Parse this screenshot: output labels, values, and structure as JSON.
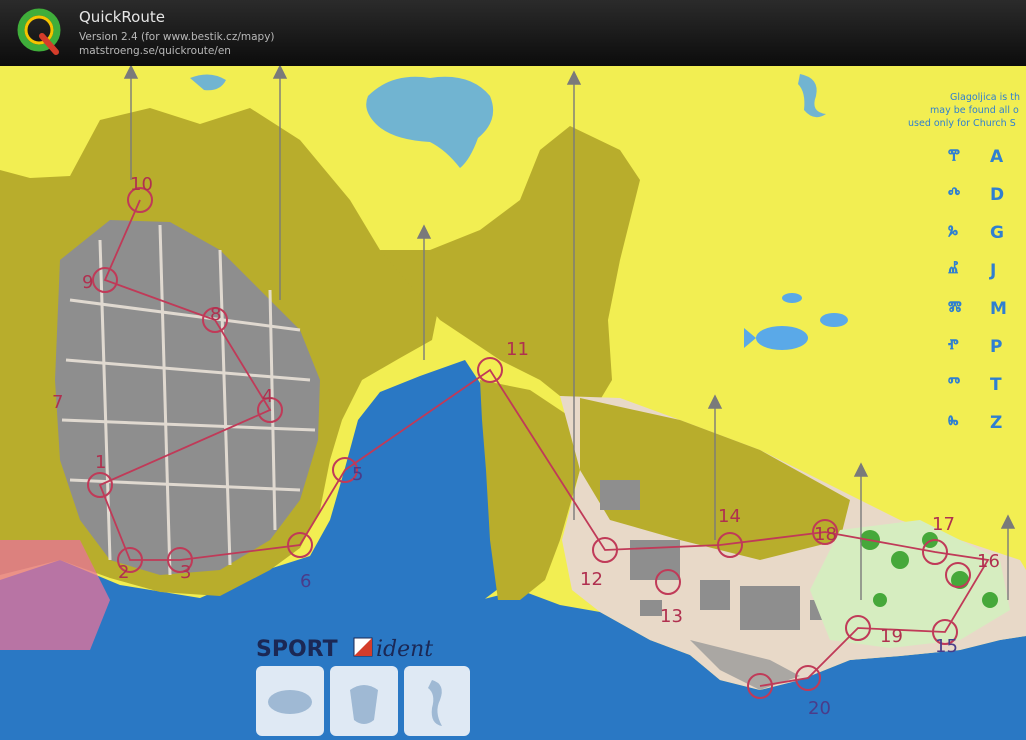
{
  "app": {
    "name": "QuickRoute",
    "version_line": "Version 2.4  (for www.bestik.cz/mapy)",
    "url_line": "matstroeng.se/quickroute/en",
    "logo_letter": "Q"
  },
  "map": {
    "legend_note": [
      "Glagoljica is th",
      "may be found all o",
      "used only for Church S"
    ],
    "glyph_legend": [
      {
        "glyph": "ⰹ",
        "latin": "A"
      },
      {
        "glyph": "ⰴ",
        "latin": "D"
      },
      {
        "glyph": "ⰳ",
        "latin": "G"
      },
      {
        "glyph": "ⰼ",
        "latin": "J"
      },
      {
        "glyph": "ⰿ",
        "latin": "M"
      },
      {
        "glyph": "ⱂ",
        "latin": "P"
      },
      {
        "glyph": "ⱅ",
        "latin": "T"
      },
      {
        "glyph": "ⰸ",
        "latin": "Z"
      }
    ],
    "controls": [
      "10",
      "9",
      "8",
      "4",
      "7",
      "1",
      "2",
      "3",
      "5",
      "6",
      "11",
      "12",
      "13",
      "14",
      "18",
      "17",
      "16",
      "19",
      "15",
      "20"
    ],
    "sponsor": {
      "sport": "SPORT",
      "ident": "ident"
    },
    "colors": {
      "sea": "#2a78c4",
      "land_open": "#f2ee52",
      "forest": "#b8ad2c",
      "built": "#8e8e8e",
      "course": "#c03a58"
    }
  }
}
